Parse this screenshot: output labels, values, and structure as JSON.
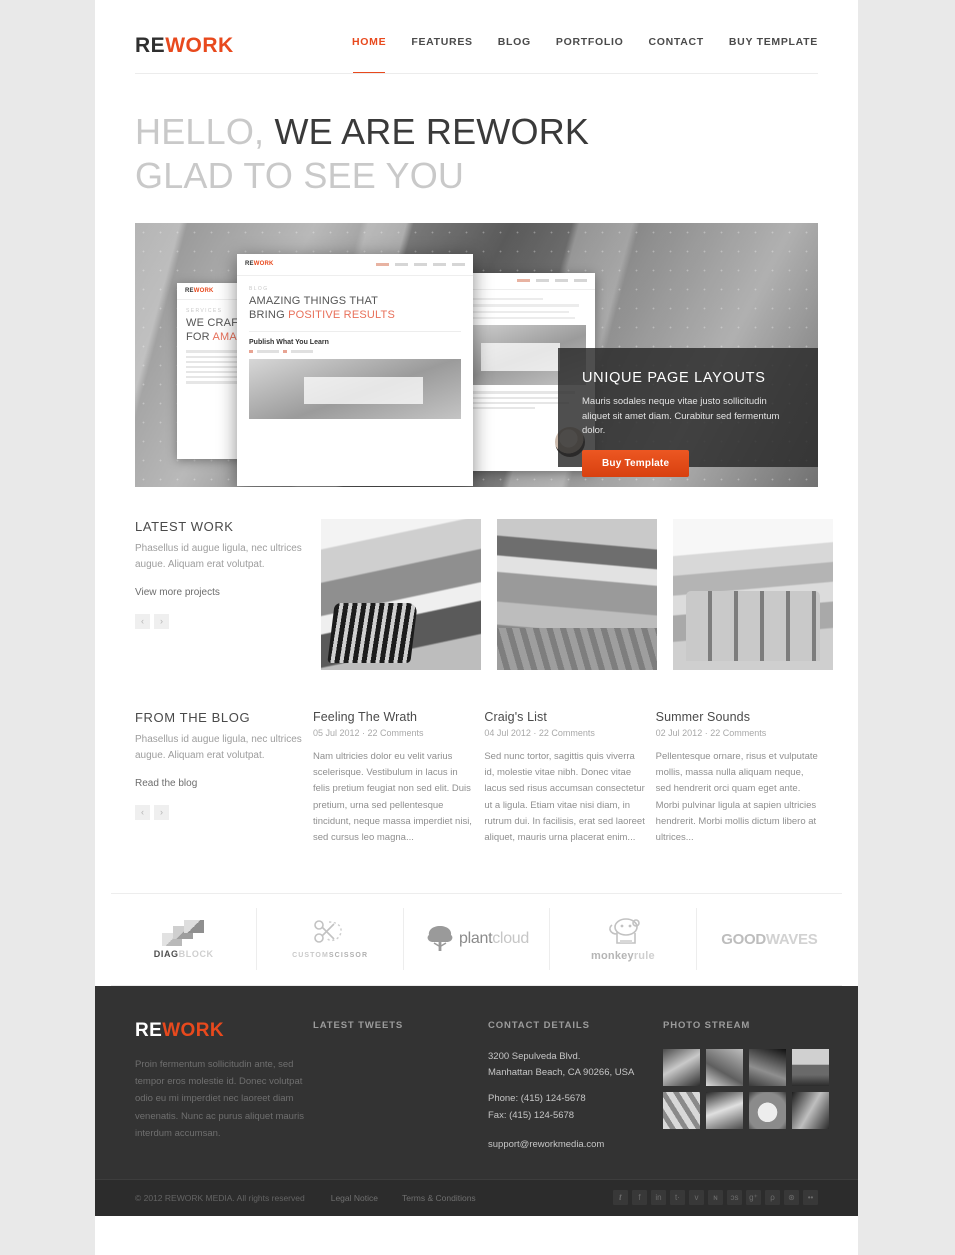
{
  "header": {
    "logo_re": "RE",
    "logo_work": "WORK",
    "nav": [
      {
        "label": "HOME",
        "active": true
      },
      {
        "label": "FEATURES",
        "active": false
      },
      {
        "label": "BLOG",
        "active": false
      },
      {
        "label": "PORTFOLIO",
        "active": false
      },
      {
        "label": "CONTACT",
        "active": false
      },
      {
        "label": "BUY TEMPLATE",
        "active": false
      }
    ]
  },
  "hero": {
    "line1_light": "HELLO,",
    "line1_dark": "WE ARE REWORK",
    "line2": "GLAD TO SEE YOU"
  },
  "slider": {
    "caption_title": "UNIQUE PAGE LAYOUTS",
    "caption_text": "Mauris sodales neque vitae justo sollicitudin aliquet sit amet diam. Curabitur sed fermentum dolor.",
    "button_label": "Buy Template",
    "mockup_front": {
      "logo_re": "RE",
      "logo_work": "WORK",
      "kicker": "BLOG",
      "heading_line1": "AMAZING THINGS THAT",
      "heading_line2_dark": "BRING ",
      "heading_line2_orange": "POSITIVE RESULTS",
      "subheading": "Publish What You Learn"
    },
    "mockup_left": {
      "logo_re": "RE",
      "logo_work": "WORK",
      "kicker": "SERVICES",
      "heading_line1": "WE CRAF",
      "heading_line2_dark": "FOR ",
      "heading_line2_orange": "AMA"
    }
  },
  "latest_work": {
    "title": "LATEST WORK",
    "description": "Phasellus id augue ligula, nec ultrices augue. Aliquam erat volutpat.",
    "link": "View more projects",
    "prev": "‹",
    "next": "›",
    "thumbs": [
      {
        "name": "car-front"
      },
      {
        "name": "car-row"
      },
      {
        "name": "plane-interior"
      }
    ]
  },
  "from_the_blog": {
    "title": "FROM THE BLOG",
    "description": "Phasellus id augue ligula, nec ultrices augue. Aliquam erat volutpat.",
    "link": "Read the blog",
    "prev": "‹",
    "next": "›",
    "posts": [
      {
        "title": "Feeling The Wrath",
        "meta": "05 Jul 2012 · 22 Comments",
        "excerpt": "Nam ultricies dolor eu velit varius scelerisque. Vestibulum in lacus in felis pretium feugiat non sed elit. Duis pretium, urna sed pellentesque tincidunt, neque massa imperdiet nisi, sed cursus leo magna..."
      },
      {
        "title": "Craig's List",
        "meta": "04 Jul 2012 · 22 Comments",
        "excerpt": "Sed nunc tortor, sagittis quis viverra id, molestie vitae nibh. Donec vitae lacus sed risus accumsan consectetur ut a ligula. Etiam vitae nisi diam, in rutrum dui. In facilisis, erat sed laoreet aliquet, mauris urna placerat enim..."
      },
      {
        "title": "Summer Sounds",
        "meta": "02 Jul 2012 · 22 Comments",
        "excerpt": "Pellentesque ornare, risus et vulputate mollis, massa nulla aliquam neque, sed hendrerit orci quam eget ante. Morbi pulvinar ligula at sapien ultricies hendrerit. Morbi mollis dictum libero at ultrices..."
      }
    ]
  },
  "clients": [
    {
      "name_dark": "DIAG",
      "name_light": "BLOCK",
      "mark": "diagblock-logo"
    },
    {
      "name_dark": "CUSTOM",
      "name_light": "SCISSOR",
      "mark": "scissor-logo"
    },
    {
      "name_dark": "plant",
      "name_light": "cloud",
      "mark": "tree-logo"
    },
    {
      "name_dark": "monkey",
      "name_light": "rule",
      "mark": "monkey-logo"
    },
    {
      "name_dark": "GOOD",
      "name_light": "WAVES",
      "mark": "goodwaves-logo"
    }
  ],
  "footer": {
    "logo_re": "RE",
    "logo_work": "WORK",
    "about": "Proin fermentum sollicitudin ante, sed tempor eros molestie id. Donec volutpat odio eu mi imperdiet nec laoreet diam venenatis. Nunc ac purus aliquet mauris interdum accumsan.",
    "tweets_head": "LATEST TWEETS",
    "contact_head": "CONTACT DETAILS",
    "address_line1": "3200 Sepulveda Blvd.",
    "address_line2": "Manhattan Beach, CA 90266, USA",
    "phone": "Phone: (415) 124-5678",
    "fax": "Fax: (415) 124-5678",
    "email": "support@reworkmedia.com",
    "photo_head": "PHOTO STREAM",
    "photos": [
      "photo-1",
      "photo-2",
      "photo-3",
      "photo-4",
      "photo-5",
      "photo-6",
      "photo-7",
      "photo-8"
    ]
  },
  "bottom": {
    "copyright": "© 2012 REWORK MEDIA. All rights reserved",
    "links": [
      "Legal Notice",
      "Terms & Conditions"
    ],
    "socials": [
      {
        "name": "twitter-icon",
        "glyph": "𝒕"
      },
      {
        "name": "facebook-icon",
        "glyph": "f"
      },
      {
        "name": "linkedin-icon",
        "glyph": "in"
      },
      {
        "name": "tumblr-icon",
        "glyph": "t·"
      },
      {
        "name": "vimeo-icon",
        "glyph": "v"
      },
      {
        "name": "rss-icon",
        "glyph": "ɴ"
      },
      {
        "name": "lastfm-icon",
        "glyph": "ɔs"
      },
      {
        "name": "googleplus-icon",
        "glyph": "g⁺"
      },
      {
        "name": "pinterest-icon",
        "glyph": "ρ"
      },
      {
        "name": "dribbble-icon",
        "glyph": "⊛"
      },
      {
        "name": "flickr-icon",
        "glyph": "••"
      }
    ]
  },
  "colors": {
    "accent": "#e8491d",
    "footer_bg": "#333333",
    "bottombar_bg": "#2c2c2c",
    "page_bg": "#e9e9e9"
  }
}
